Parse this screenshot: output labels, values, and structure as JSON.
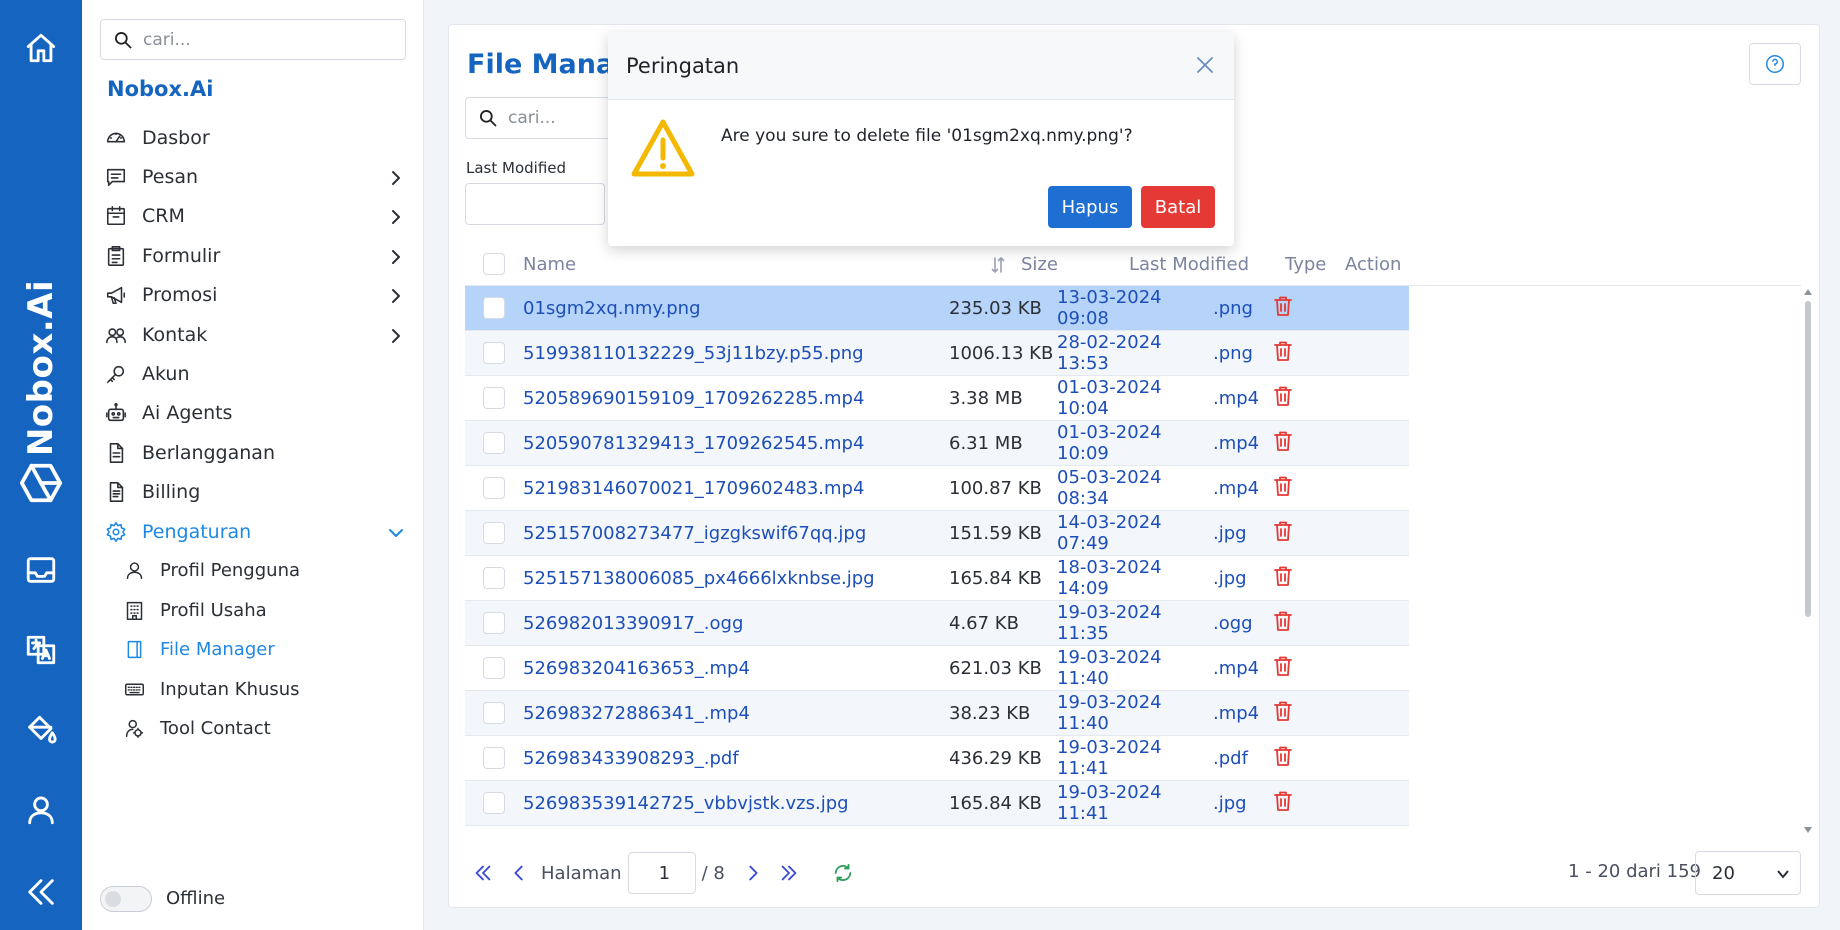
{
  "brand": "Nobox.Ai",
  "rail": {
    "icons": [
      "home-icon",
      "nobox-logo-icon",
      "inbox-icon",
      "translate-icon",
      "paint-bucket-icon",
      "user-icon",
      "collapse-icon"
    ]
  },
  "sidebar": {
    "search_placeholder": "cari...",
    "title": "Nobox.Ai",
    "items": [
      {
        "label": "Dasbor",
        "icon": "dashboard-icon",
        "has_children": false
      },
      {
        "label": "Pesan",
        "icon": "message-icon",
        "has_children": true
      },
      {
        "label": "CRM",
        "icon": "crm-icon",
        "has_children": true
      },
      {
        "label": "Formulir",
        "icon": "form-icon",
        "has_children": true
      },
      {
        "label": "Promosi",
        "icon": "megaphone-icon",
        "has_children": true
      },
      {
        "label": "Kontak",
        "icon": "contacts-icon",
        "has_children": true
      },
      {
        "label": "Akun",
        "icon": "key-icon",
        "has_children": false
      },
      {
        "label": "Ai Agents",
        "icon": "robot-icon",
        "has_children": false
      },
      {
        "label": "Berlangganan",
        "icon": "document-icon",
        "has_children": false
      },
      {
        "label": "Billing",
        "icon": "billing-icon",
        "has_children": false
      },
      {
        "label": "Pengaturan",
        "icon": "settings-icon",
        "has_children": true,
        "expanded": true
      }
    ],
    "sub_items": [
      {
        "label": "Profil Pengguna",
        "icon": "user-icon"
      },
      {
        "label": "Profil Usaha",
        "icon": "building-icon"
      },
      {
        "label": "File Manager",
        "icon": "file-icon",
        "active": true
      },
      {
        "label": "Inputan Khusus",
        "icon": "keyboard-icon"
      },
      {
        "label": "Tool Contact",
        "icon": "tool-contact-icon"
      }
    ],
    "status_label": "Offline"
  },
  "main": {
    "title": "File Manager",
    "search_placeholder": "cari...",
    "last_modified_label": "Last Modified",
    "columns": {
      "name": "Name",
      "size": "Size",
      "last_modified": "Last Modified",
      "type": "Type",
      "action": "Action"
    },
    "rows": [
      {
        "name": "01sgm2xq.nmy.png",
        "size": "235.03 KB",
        "modified": "13-03-2024 09:08",
        "type": ".png",
        "selected": true
      },
      {
        "name": "519938110132229_53j11bzy.p55.png",
        "size": "1006.13 KB",
        "modified": "28-02-2024 13:53",
        "type": ".png"
      },
      {
        "name": "520589690159109_1709262285.mp4",
        "size": "3.38 MB",
        "modified": "01-03-2024 10:04",
        "type": ".mp4"
      },
      {
        "name": "520590781329413_1709262545.mp4",
        "size": "6.31 MB",
        "modified": "01-03-2024 10:09",
        "type": ".mp4"
      },
      {
        "name": "521983146070021_1709602483.mp4",
        "size": "100.87 KB",
        "modified": "05-03-2024 08:34",
        "type": ".mp4"
      },
      {
        "name": "525157008273477_igzgkswif67qq.jpg",
        "size": "151.59 KB",
        "modified": "14-03-2024 07:49",
        "type": ".jpg"
      },
      {
        "name": "525157138006085_px4666lxknbse.jpg",
        "size": "165.84 KB",
        "modified": "18-03-2024 14:09",
        "type": ".jpg"
      },
      {
        "name": "526982013390917_.ogg",
        "size": "4.67 KB",
        "modified": "19-03-2024 11:35",
        "type": ".ogg"
      },
      {
        "name": "526983204163653_.mp4",
        "size": "621.03 KB",
        "modified": "19-03-2024 11:40",
        "type": ".mp4"
      },
      {
        "name": "526983272886341_.mp4",
        "size": "38.23 KB",
        "modified": "19-03-2024 11:40",
        "type": ".mp4"
      },
      {
        "name": "526983433908293_.pdf",
        "size": "436.29 KB",
        "modified": "19-03-2024 11:41",
        "type": ".pdf"
      },
      {
        "name": "526983539142725_vbbvjstk.vzs.jpg",
        "size": "165.84 KB",
        "modified": "19-03-2024 11:41",
        "type": ".jpg"
      }
    ],
    "pager": {
      "label": "Halaman",
      "current": "1",
      "total": "/ 8",
      "info": "1 - 20 dari 159",
      "page_size": "20"
    }
  },
  "modal": {
    "title": "Peringatan",
    "message": "Are you sure to delete file '01sgm2xq.nmy.png'?",
    "confirm_label": "Hapus",
    "cancel_label": "Batal"
  },
  "colors": {
    "brand": "#1565c0",
    "link": "#1d4fb8",
    "active": "#1e88e5",
    "selected_row": "#b6d3fa",
    "danger": "#e53935",
    "warning": "#f5b800"
  }
}
